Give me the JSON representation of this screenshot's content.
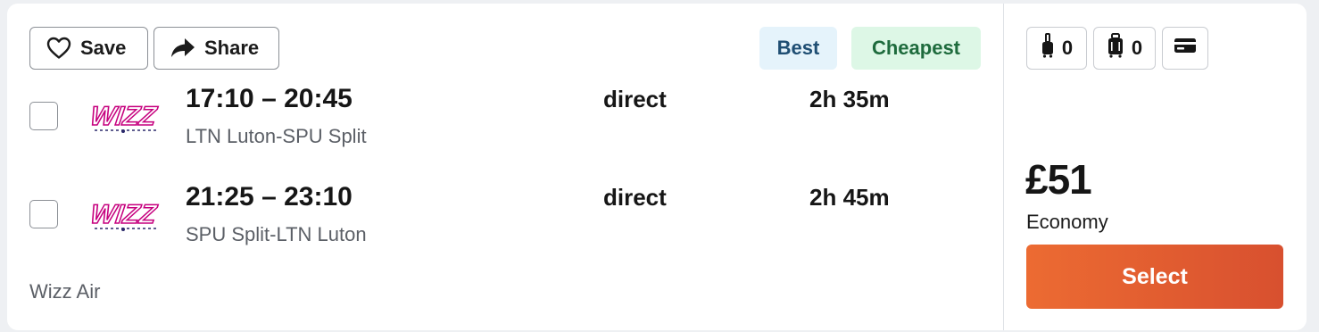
{
  "actions": {
    "save_label": "Save",
    "share_label": "Share",
    "save_icon": "heart-icon",
    "share_icon": "share-arrow-icon"
  },
  "badges": {
    "best": "Best",
    "cheapest": "Cheapest"
  },
  "legs": [
    {
      "times": "17:10 – 20:45",
      "route": "LTN Luton-SPU Split",
      "stops": "direct",
      "duration": "2h 35m"
    },
    {
      "times": "21:25 – 23:10",
      "route": "SPU Split-LTN Luton",
      "stops": "direct",
      "duration": "2h 45m"
    }
  ],
  "airline": {
    "name": "Wizz Air",
    "logo_text": "WIZZ",
    "logo_colors": [
      "#c6007e",
      "#2b2a6b"
    ]
  },
  "baggage": {
    "cabin_bag_count": "0",
    "checked_bag_count": "0",
    "cabin_bag_icon": "cabin-bag-icon",
    "checked_bag_icon": "checked-bag-icon",
    "card_icon": "credit-card-icon"
  },
  "fare": {
    "price": "£51",
    "cabin_class": "Economy",
    "select_label": "Select"
  },
  "colors": {
    "select_gradient_start": "#ec6b32",
    "select_gradient_end": "#d8502f",
    "best_bg": "#e5f3fb",
    "cheapest_bg": "#ddf7e6"
  }
}
